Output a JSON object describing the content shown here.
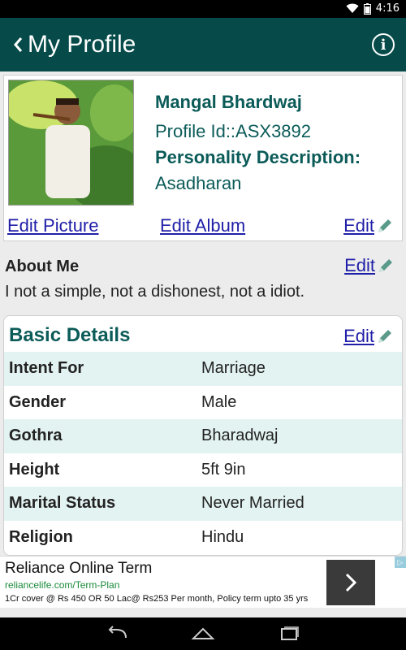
{
  "status": {
    "time": "4:16"
  },
  "app_bar": {
    "title": "My Profile"
  },
  "profile": {
    "name": "Mangal Bhardwaj",
    "profile_id": "Profile Id::ASX3892",
    "personality_label": "Personality Description:",
    "personality_value": "Asadharan",
    "edit_picture": "Edit Picture",
    "edit_album": "Edit Album",
    "edit": "Edit"
  },
  "about": {
    "title": "About Me",
    "edit": "Edit",
    "text": "I not a simple, not a dishonest, not a idiot."
  },
  "basic_details": {
    "title": "Basic Details",
    "edit": "Edit",
    "rows": [
      {
        "label": "Intent For",
        "value": "Marriage"
      },
      {
        "label": "Gender",
        "value": "Male"
      },
      {
        "label": "Gothra",
        "value": "Bharadwaj"
      },
      {
        "label": "Height",
        "value": "5ft 9in"
      },
      {
        "label": "Marital Status",
        "value": "Never Married"
      },
      {
        "label": "Religion",
        "value": "Hindu"
      }
    ]
  },
  "ad": {
    "title": "Reliance Online Term",
    "url": "reliancelife.com/Term-Plan",
    "description": "1Cr cover @ Rs 450 OR 50 Lac@ Rs253 Per month, Policy term upto 35 yrs"
  },
  "colors": {
    "app_bar": "#064b4a",
    "accent": "#0b5b59",
    "link": "#1f1fa8",
    "row_shade": "#e3f3f2"
  }
}
